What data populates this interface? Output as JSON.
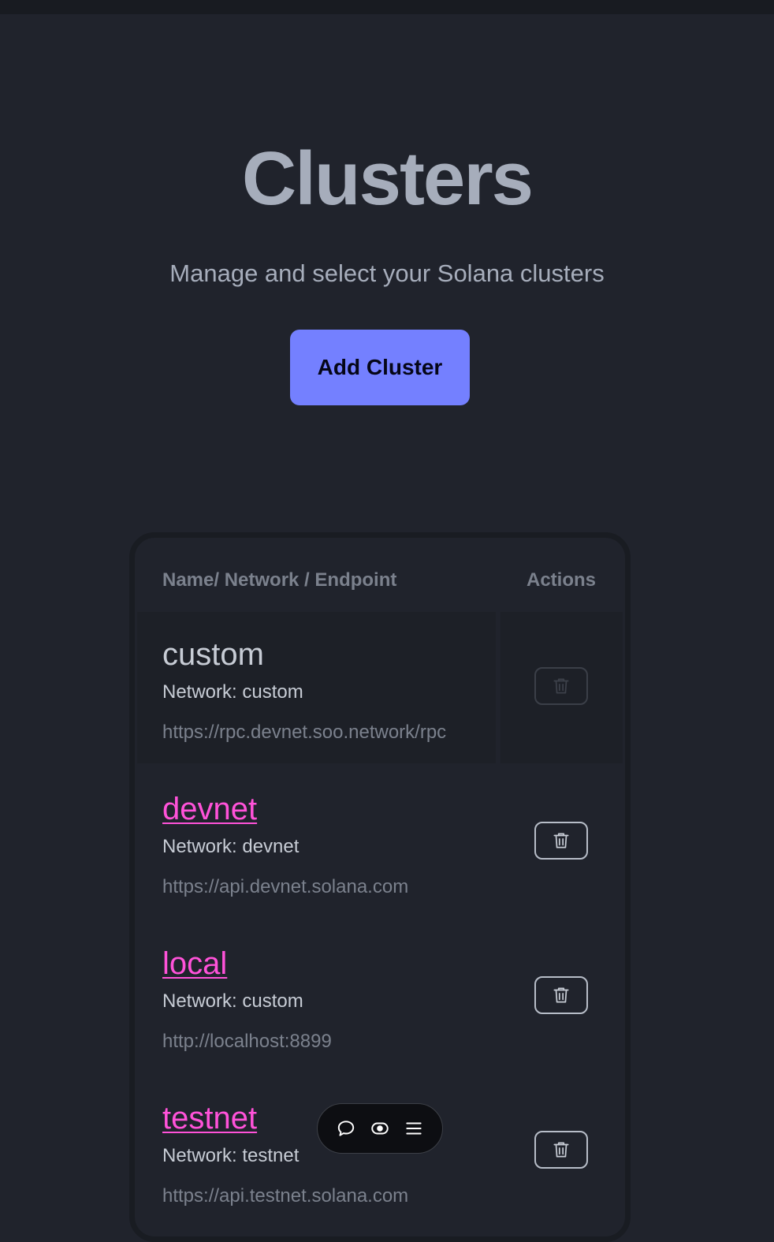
{
  "page": {
    "title": "Clusters",
    "subtitle": "Manage and select your Solana clusters",
    "add_button_label": "Add Cluster"
  },
  "table": {
    "headers": {
      "name": "Name/ Network / Endpoint",
      "actions": "Actions"
    },
    "rows": [
      {
        "name": "custom",
        "network": "Network: custom",
        "endpoint": "https://rpc.devnet.soo.network/rpc",
        "active": true
      },
      {
        "name": "devnet",
        "network": "Network: devnet",
        "endpoint": "https://api.devnet.solana.com",
        "active": false
      },
      {
        "name": "local",
        "network": "Network: custom",
        "endpoint": "http://localhost:8899",
        "active": false
      },
      {
        "name": "testnet",
        "network": "Network: testnet",
        "endpoint": "https://api.testnet.solana.com",
        "active": false
      }
    ]
  },
  "floating_toolbar": {
    "icons": [
      "chat-icon",
      "eye-icon",
      "menu-icon"
    ]
  },
  "colors": {
    "background": "#20232c",
    "primary": "#7480ff",
    "link": "#ff52d9",
    "text": "#a6adbb",
    "muted": "#7b818d"
  }
}
